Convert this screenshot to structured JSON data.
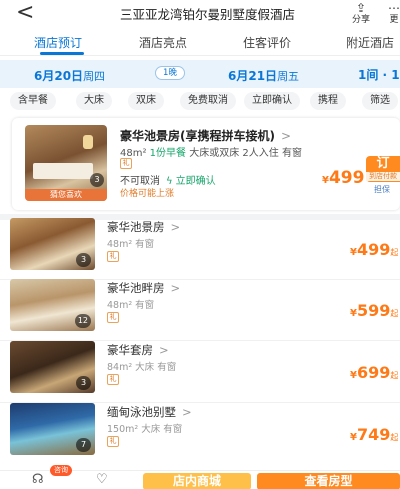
{
  "header": {
    "back_glyph": "<",
    "title": "三亚亚龙湾铂尔曼别墅度假酒店",
    "share_label": "分享",
    "more_label": "更"
  },
  "tabs": [
    {
      "label": "酒店预订",
      "active": true
    },
    {
      "label": "酒店亮点",
      "active": false
    },
    {
      "label": "住客评价",
      "active": false
    },
    {
      "label": "附近酒店",
      "active": false
    }
  ],
  "dates": {
    "checkin_date": "6月20日",
    "checkin_weekday": "周四",
    "nights": "1晚",
    "checkout_date": "6月21日",
    "checkout_weekday": "周五",
    "rooms": "1间 · 1"
  },
  "filters": [
    "含早餐",
    "大床",
    "双床",
    "免费取消",
    "立即确认",
    "携程",
    "筛选"
  ],
  "featured": {
    "name": "豪华池景房(享携程拼车接机)",
    "area": "48m²",
    "breakfast": "1份早餐",
    "bed": "大床或双床",
    "guests": "2人入住",
    "window": "有窗",
    "gift": "礼",
    "cancel": "不可取消",
    "confirm": "立即确认",
    "price_note": "价格可能上涨",
    "photo_count": "3",
    "tag": "猜您喜欢",
    "currency": "¥",
    "price": "499",
    "book_label": "订",
    "book_sub": "到店付款",
    "guarantee": "担保",
    "colors": {
      "price": "#ff7a16",
      "primary": "#0a77d6",
      "confirm": "#17a56b"
    }
  },
  "rooms": [
    {
      "name": "豪华池景房",
      "meta": "48m²  有窗",
      "gift": "礼",
      "photos": "3",
      "currency": "¥",
      "price": "499",
      "qi": "起"
    },
    {
      "name": "豪华池畔房",
      "meta": "48m²  有窗",
      "gift": "礼",
      "photos": "12",
      "currency": "¥",
      "price": "599",
      "qi": "起"
    },
    {
      "name": "豪华套房",
      "meta": "84m²  大床  有窗",
      "gift": "礼",
      "photos": "3",
      "currency": "¥",
      "price": "699",
      "qi": "起"
    },
    {
      "name": "缅甸泳池别墅",
      "meta": "150m²  大床  有窗",
      "gift": "礼",
      "photos": "7",
      "currency": "¥",
      "price": "749",
      "qi": "起"
    }
  ],
  "bottom": {
    "consult_badge": "咨询",
    "mall_label": "店内商城",
    "rooms_label": "查看房型"
  },
  "icons": {
    "back": "chevron-left-icon",
    "share": "share-icon",
    "service": "headset-icon",
    "favorite": "heart-icon",
    "flash": "lightning-icon"
  }
}
